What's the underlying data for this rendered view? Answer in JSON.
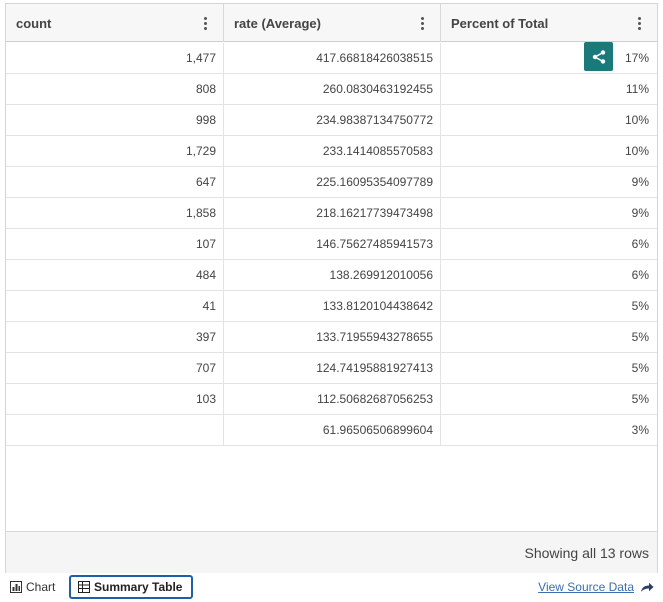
{
  "table": {
    "columns": [
      {
        "label": "count"
      },
      {
        "label": "rate (Average)"
      },
      {
        "label": "Percent of Total"
      }
    ],
    "rows": [
      {
        "count": "1,477",
        "rate": "417.66818426038515",
        "percent": "17%"
      },
      {
        "count": "808",
        "rate": "260.0830463192455",
        "percent": "11%"
      },
      {
        "count": "998",
        "rate": "234.98387134750772",
        "percent": "10%"
      },
      {
        "count": "1,729",
        "rate": "233.1414085570583",
        "percent": "10%"
      },
      {
        "count": "647",
        "rate": "225.16095354097789",
        "percent": "9%"
      },
      {
        "count": "1,858",
        "rate": "218.16217739473498",
        "percent": "9%"
      },
      {
        "count": "107",
        "rate": "146.75627485941573",
        "percent": "6%"
      },
      {
        "count": "484",
        "rate": "138.269912010056",
        "percent": "6%"
      },
      {
        "count": "41",
        "rate": "133.8120104438642",
        "percent": "5%"
      },
      {
        "count": "397",
        "rate": "133.71955943278655",
        "percent": "5%"
      },
      {
        "count": "707",
        "rate": "124.74195881927413",
        "percent": "5%"
      },
      {
        "count": "103",
        "rate": "112.50682687056253",
        "percent": "5%"
      },
      {
        "count": "",
        "rate": "61.96506506899604",
        "percent": "3%"
      }
    ]
  },
  "footer": {
    "row_count_text": "Showing all 13 rows"
  },
  "bottom_tabs": {
    "chart_label": "Chart",
    "summary_label": "Summary Table",
    "view_source_label": "View Source Data"
  },
  "colors": {
    "share_button": "#1a7a7a",
    "active_tab_border": "#1f5fa8",
    "link": "#3a6fb0"
  },
  "icons": {
    "share": "share-icon",
    "column_menu": "kebab-menu-icon",
    "chart": "chart-icon",
    "table": "table-icon",
    "export": "share-arrow-icon"
  }
}
